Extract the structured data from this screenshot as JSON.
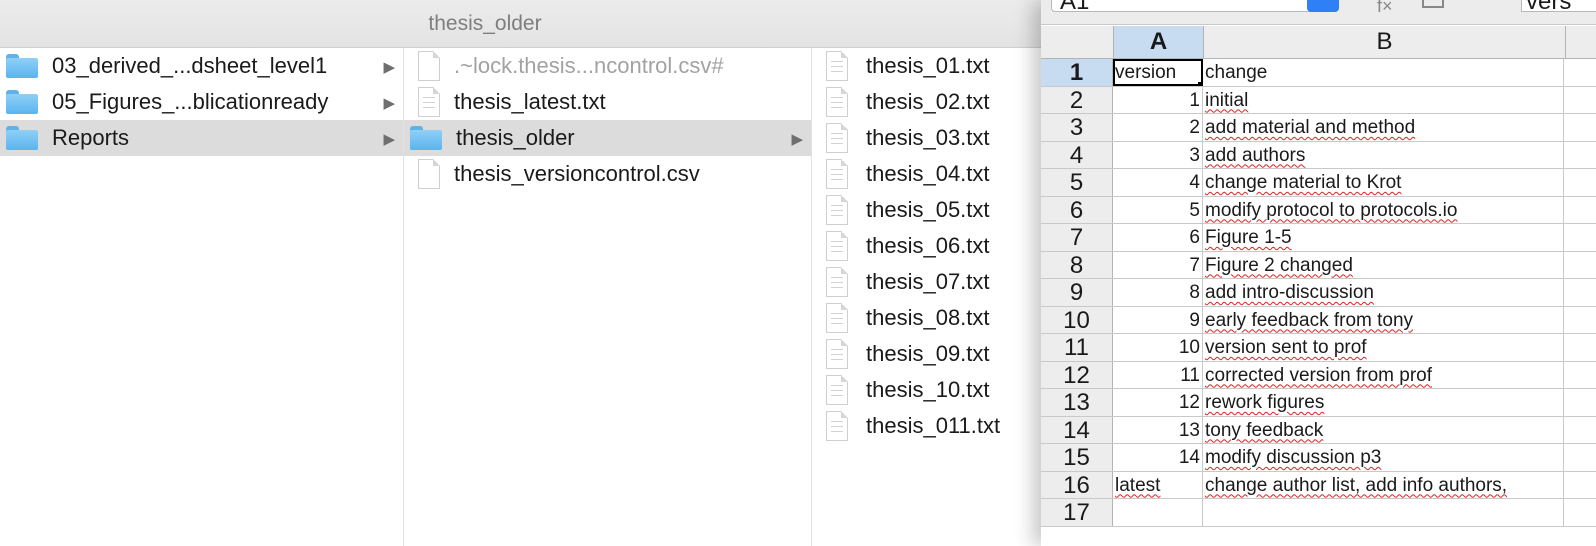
{
  "finder": {
    "title": "thesis_older",
    "col1": [
      {
        "name": "03_derived_...dsheet_level1",
        "type": "folder",
        "selected": false
      },
      {
        "name": "05_Figures_...blicationready",
        "type": "folder",
        "selected": false
      },
      {
        "name": "Reports",
        "type": "folder",
        "selected": true
      }
    ],
    "col2": [
      {
        "name": ".~lock.thesis...ncontrol.csv#",
        "type": "file",
        "dim": true
      },
      {
        "name": "thesis_latest.txt",
        "type": "textfile"
      },
      {
        "name": "thesis_older",
        "type": "folder",
        "selected": true
      },
      {
        "name": "thesis_versioncontrol.csv",
        "type": "file"
      }
    ],
    "col3": [
      "thesis_01.txt",
      "thesis_02.txt",
      "thesis_03.txt",
      "thesis_04.txt",
      "thesis_05.txt",
      "thesis_06.txt",
      "thesis_07.txt",
      "thesis_08.txt",
      "thesis_09.txt",
      "thesis_10.txt",
      "thesis_011.txt"
    ]
  },
  "spreadsheet": {
    "name_box": "A1",
    "formula_value": "vers",
    "columns": [
      "A",
      "B"
    ],
    "rows": [
      {
        "n": "1",
        "a": "version",
        "b": "change"
      },
      {
        "n": "2",
        "a": "1",
        "b": "initial"
      },
      {
        "n": "3",
        "a": "2",
        "b": "add material and method"
      },
      {
        "n": "4",
        "a": "3",
        "b": "add authors"
      },
      {
        "n": "5",
        "a": "4",
        "b": "change material to Krot"
      },
      {
        "n": "6",
        "a": "5",
        "b": "modify protocol to protocols.io"
      },
      {
        "n": "7",
        "a": "6",
        "b": "Figure 1-5"
      },
      {
        "n": "8",
        "a": "7",
        "b": "Figure 2 changed"
      },
      {
        "n": "9",
        "a": "8",
        "b": "add intro-discussion"
      },
      {
        "n": "10",
        "a": "9",
        "b": "early feedback from tony"
      },
      {
        "n": "11",
        "a": "10",
        "b": "version sent to prof"
      },
      {
        "n": "12",
        "a": "11",
        "b": "corrected version from prof"
      },
      {
        "n": "13",
        "a": "12",
        "b": "rework figures"
      },
      {
        "n": "14",
        "a": "13",
        "b": "tony feedback"
      },
      {
        "n": "15",
        "a": "14",
        "b": "modify discussion p3"
      },
      {
        "n": "16",
        "a": "latest",
        "b": "change author list, add info authors,"
      },
      {
        "n": "17",
        "a": "",
        "b": ""
      }
    ]
  }
}
